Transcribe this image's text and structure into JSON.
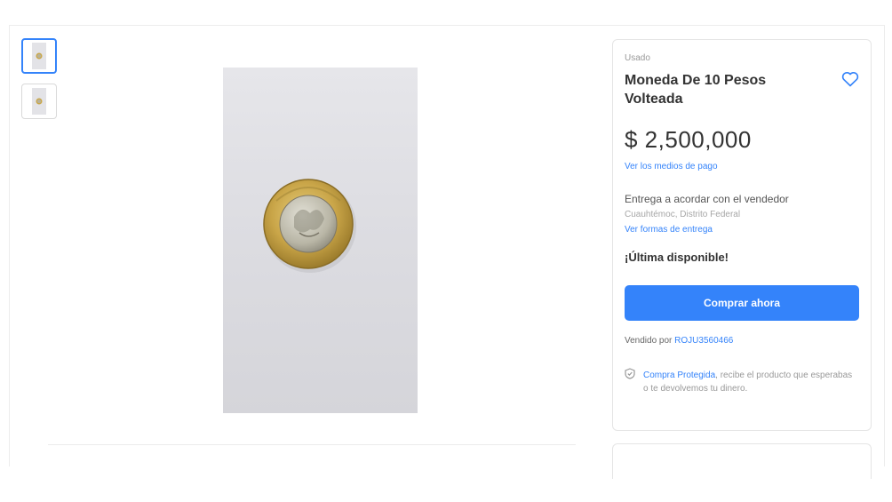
{
  "gallery": {
    "thumbnails": [
      {
        "alt": "Moneda De 10 Pesos Volteada",
        "selected": true
      },
      {
        "alt": "Moneda De 10 Pesos Volteada",
        "selected": false
      }
    ]
  },
  "product": {
    "condition": "Usado",
    "title": "Moneda De 10 Pesos Volteada",
    "price": "$ 2,500,000",
    "payment_link": "Ver los medios de pago",
    "delivery": "Entrega a acordar con el vendedor",
    "location": "Cuauhtémoc, Distrito Federal",
    "delivery_link": "Ver formas de entrega",
    "stock": "¡Última disponible!",
    "buy_button": "Comprar ahora",
    "seller_prefix": "Vendido por",
    "seller_name": "ROJU3560466",
    "protection_link": "Compra Protegida",
    "protection_text": ", recibe el producto que esperabas o te devolvemos tu dinero."
  },
  "colors": {
    "accent": "#3483fa",
    "text_primary": "#333333",
    "text_muted": "#999999",
    "border": "#e5e5e5"
  },
  "icons": {
    "favorite": "heart-outline-icon",
    "protection": "shield-check-icon"
  }
}
